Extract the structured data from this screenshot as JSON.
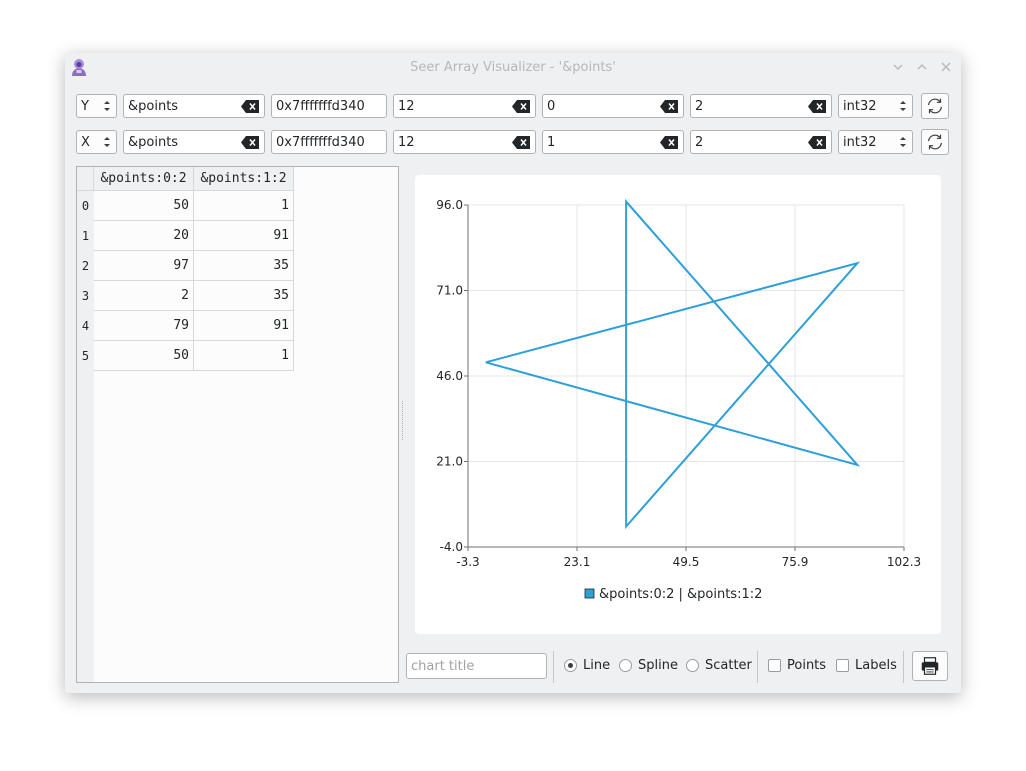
{
  "window": {
    "title": "Seer Array Visualizer - '&points'"
  },
  "rows": [
    {
      "axis": "Y",
      "variable": "&points",
      "address": "0x7fffffffd340",
      "length": "12",
      "offset": "0",
      "stride": "2",
      "type": "int32"
    },
    {
      "axis": "X",
      "variable": "&points",
      "address": "0x7fffffffd340",
      "length": "12",
      "offset": "1",
      "stride": "2",
      "type": "int32"
    }
  ],
  "table": {
    "headers": [
      "&points:0:2",
      "&points:1:2"
    ],
    "row_numbers": [
      "0",
      "1",
      "2",
      "3",
      "4",
      "5"
    ],
    "rows": [
      [
        "50",
        "1"
      ],
      [
        "20",
        "91"
      ],
      [
        "97",
        "35"
      ],
      [
        "2",
        "35"
      ],
      [
        "79",
        "91"
      ],
      [
        "50",
        "1"
      ]
    ]
  },
  "chart_data": {
    "type": "line",
    "title": "",
    "xlabel": "",
    "ylabel": "",
    "xlim": [
      -3.3,
      102.3
    ],
    "ylim": [
      -4.0,
      96.0
    ],
    "x_ticks": [
      "-3.3",
      "23.1",
      "49.5",
      "75.9",
      "102.3"
    ],
    "y_ticks": [
      "96.0",
      "71.0",
      "46.0",
      "21.0",
      "-4.0"
    ],
    "grid": true,
    "legend": "bottom-center",
    "series": [
      {
        "name": "&points:0:2 | &points:1:2",
        "color": "#2d9fd9",
        "x": [
          1,
          91,
          35,
          35,
          91,
          1
        ],
        "y": [
          50,
          20,
          97,
          2,
          79,
          50
        ]
      }
    ]
  },
  "controls": {
    "chart_title_placeholder": "chart title",
    "line_label": "Line",
    "spline_label": "Spline",
    "scatter_label": "Scatter",
    "points_label": "Points",
    "labels_label": "Labels",
    "selected_mode": "Line"
  }
}
